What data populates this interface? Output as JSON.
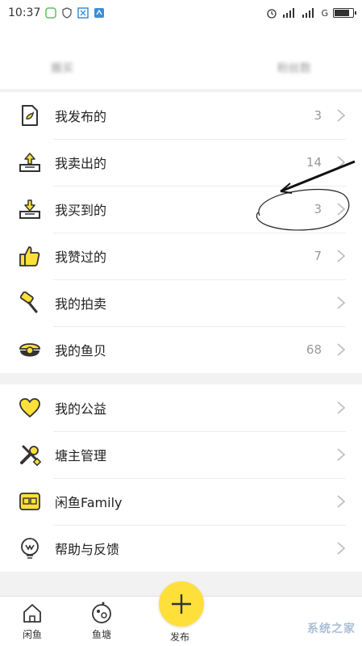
{
  "status_bar": {
    "time": "10:37",
    "carrier_right": "G"
  },
  "stats_row": [
    "搬买",
    "",
    "粉丝数"
  ],
  "group1": [
    {
      "label": "我发布的",
      "count": "3",
      "icon": "document-leaf-icon"
    },
    {
      "label": "我卖出的",
      "count": "14",
      "icon": "box-upload-icon"
    },
    {
      "label": "我买到的",
      "count": "3",
      "icon": "box-download-icon"
    },
    {
      "label": "我赞过的",
      "count": "7",
      "icon": "thumbs-up-icon"
    },
    {
      "label": "我的拍卖",
      "count": "",
      "icon": "auction-hammer-icon"
    },
    {
      "label": "我的鱼贝",
      "count": "68",
      "icon": "shell-pearl-icon"
    }
  ],
  "group2": [
    {
      "label": "我的公益",
      "icon": "heart-icon"
    },
    {
      "label": "塘主管理",
      "icon": "tools-icon"
    },
    {
      "label": "闲鱼Family",
      "icon": "family-card-icon"
    },
    {
      "label": "帮助与反馈",
      "icon": "help-bulb-icon"
    }
  ],
  "tab_bar": {
    "home_label": "闲鱼",
    "pond_label": "鱼塘",
    "publish_label": "发布"
  },
  "watermark": "系统之家",
  "colors": {
    "accent": "#ffe03a",
    "icon_dark": "#333333",
    "text_secondary": "#999999"
  }
}
